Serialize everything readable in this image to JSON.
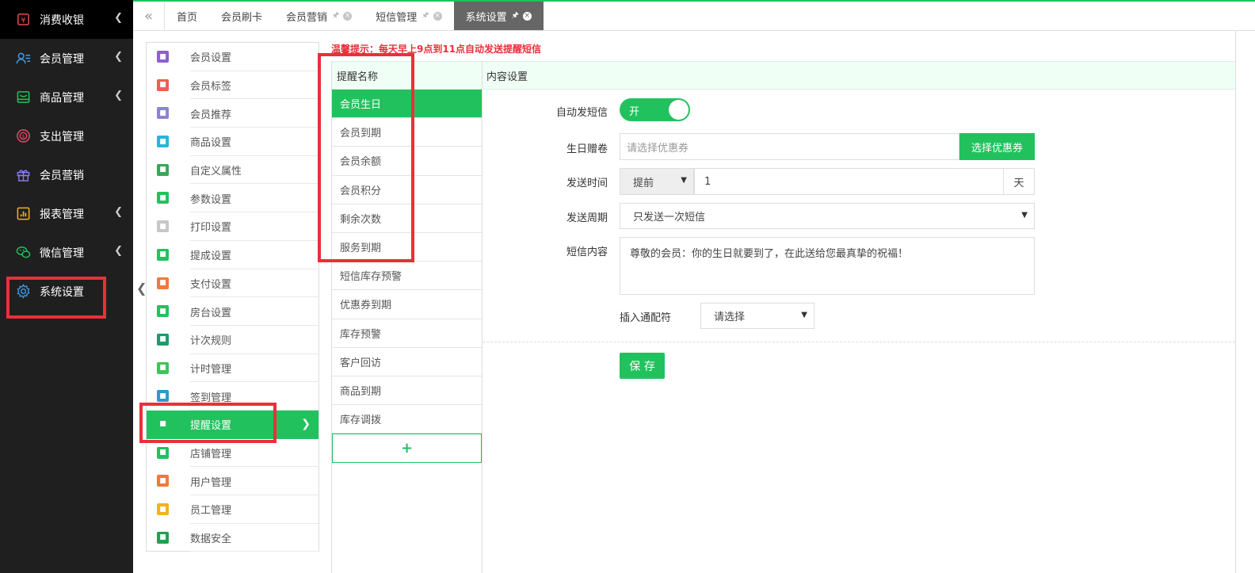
{
  "sidebar": {
    "items": [
      {
        "label": "消费收银",
        "icon": "cashier-icon",
        "arrow": true
      },
      {
        "label": "会员管理",
        "icon": "member-icon",
        "arrow": true
      },
      {
        "label": "商品管理",
        "icon": "goods-icon",
        "arrow": true
      },
      {
        "label": "支出管理",
        "icon": "expense-icon",
        "arrow": false
      },
      {
        "label": "会员营销",
        "icon": "gift-icon",
        "arrow": false
      },
      {
        "label": "报表管理",
        "icon": "report-icon",
        "arrow": true
      },
      {
        "label": "微信管理",
        "icon": "wechat-icon",
        "arrow": true
      },
      {
        "label": "系统设置",
        "icon": "gear-icon",
        "arrow": false
      }
    ]
  },
  "tabs": [
    {
      "label": "首页",
      "active": false,
      "closable": false
    },
    {
      "label": "会员刷卡",
      "active": false,
      "closable": false
    },
    {
      "label": "会员营销",
      "active": false,
      "closable": true
    },
    {
      "label": "短信管理",
      "active": false,
      "closable": true
    },
    {
      "label": "系统设置",
      "active": true,
      "closable": true
    }
  ],
  "settings_menu": {
    "items": [
      {
        "label": "会员设置",
        "color": "#8e5fcf"
      },
      {
        "label": "会员标签",
        "color": "#f25c54"
      },
      {
        "label": "会员推荐",
        "color": "#8a84d6"
      },
      {
        "label": "商品设置",
        "color": "#26b7d9"
      },
      {
        "label": "自定义属性",
        "color": "#3aa657"
      },
      {
        "label": "参数设置",
        "color": "#21c25e"
      },
      {
        "label": "打印设置",
        "color": "#c7c7c7"
      },
      {
        "label": "提成设置",
        "color": "#21c25e"
      },
      {
        "label": "支付设置",
        "color": "#f2783c"
      },
      {
        "label": "房台设置",
        "color": "#21c25e"
      },
      {
        "label": "计次规则",
        "color": "#1f9a6b"
      },
      {
        "label": "计时管理",
        "color": "#3fc45a"
      },
      {
        "label": "签到管理",
        "color": "#2a9bc8"
      },
      {
        "label": "提醒设置",
        "color": "#21c25e"
      },
      {
        "label": "店铺管理",
        "color": "#21c25e"
      },
      {
        "label": "用户管理",
        "color": "#f2783c"
      },
      {
        "label": "员工管理",
        "color": "#f2b21c"
      },
      {
        "label": "数据安全",
        "color": "#21a052"
      }
    ],
    "active_index": 13
  },
  "tip": "温馨提示：每天早上9点到11点自动发送提醒短信",
  "reminder_list": {
    "header": "提醒名称",
    "items": [
      "会员生日",
      "会员到期",
      "会员余额",
      "会员积分",
      "剩余次数",
      "服务到期",
      "短信库存预警",
      "优惠券到期",
      "库存预警",
      "客户回访",
      "商品到期",
      "库存调拨"
    ],
    "active_index": 0,
    "add_label": "+"
  },
  "content": {
    "header": "内容设置",
    "auto_sms_label": "自动发短信",
    "auto_sms_toggle": "开",
    "coupon_label": "生日赠卷",
    "coupon_placeholder": "请选择优惠券",
    "coupon_button": "选择优惠券",
    "send_time_label": "发送时间",
    "send_time_mode": "提前",
    "send_time_value": "1",
    "send_time_unit": "天",
    "cycle_label": "发送周期",
    "cycle_value": "只发送一次短信",
    "sms_content_label": "短信内容",
    "sms_content_value": "尊敬的会员：你的生日就要到了，在此送给您最真挚的祝福！",
    "wildcard_label": "插入通配符",
    "wildcard_value": "请选择",
    "save_button": "保 存"
  }
}
